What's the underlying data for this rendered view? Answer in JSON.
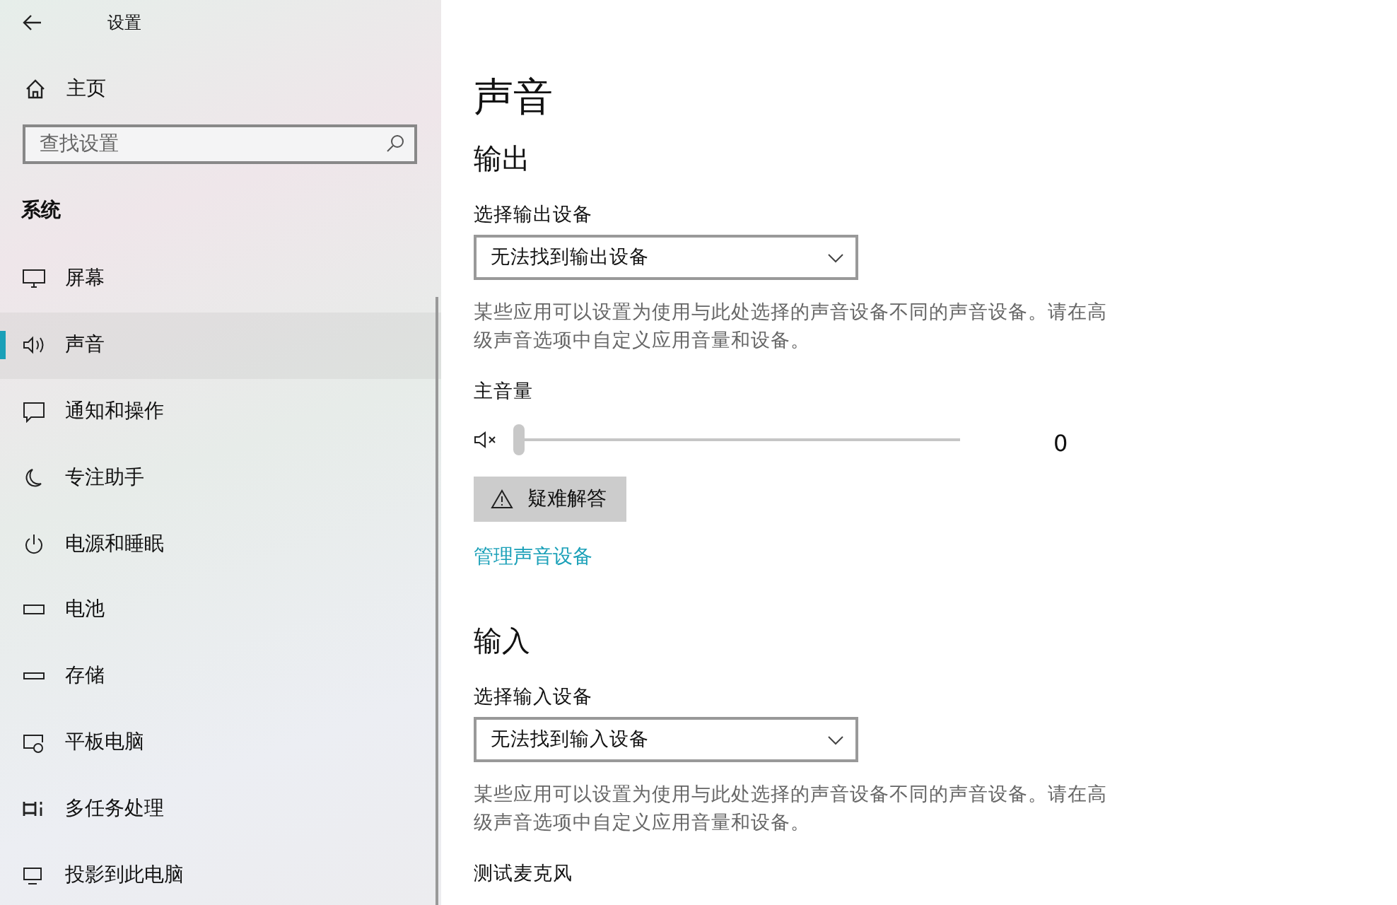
{
  "window": {
    "title": "设置"
  },
  "sidebar": {
    "home": "主页",
    "search": {
      "placeholder": "查找设置"
    },
    "section": "系统",
    "items": [
      {
        "kind": "display",
        "label": "屏幕",
        "selected": false
      },
      {
        "kind": "sound",
        "label": "声音",
        "selected": true
      },
      {
        "kind": "notification",
        "label": "通知和操作",
        "selected": false
      },
      {
        "kind": "focus",
        "label": "专注助手",
        "selected": false
      },
      {
        "kind": "power",
        "label": "电源和睡眠",
        "selected": false
      },
      {
        "kind": "battery",
        "label": "电池",
        "selected": false
      },
      {
        "kind": "storage",
        "label": "存储",
        "selected": false
      },
      {
        "kind": "tablet",
        "label": "平板电脑",
        "selected": false
      },
      {
        "kind": "multitask",
        "label": "多任务处理",
        "selected": false
      },
      {
        "kind": "project",
        "label": "投影到此电脑",
        "selected": false
      }
    ]
  },
  "page": {
    "title": "声音",
    "output": {
      "heading": "输出",
      "device_label": "选择输出设备",
      "device": "无法找到输出设备",
      "note": "某些应用可以设置为使用与此处选择的声音设备不同的声音设备。请在高级声音选项中自定义应用音量和设备。",
      "volume_label": "主音量",
      "volume": {
        "level": 0,
        "reading": "0"
      },
      "troubleshoot": "疑难解答",
      "manage_link": "管理声音设备"
    },
    "input": {
      "heading": "输入",
      "device_label": "选择输入设备",
      "device": "无法找到输入设备",
      "note": "某些应用可以设置为使用与此处选择的声音设备不同的声音设备。请在高级声音选项中自定义应用音量和设备。",
      "test_label": "测试麦克风"
    }
  }
}
